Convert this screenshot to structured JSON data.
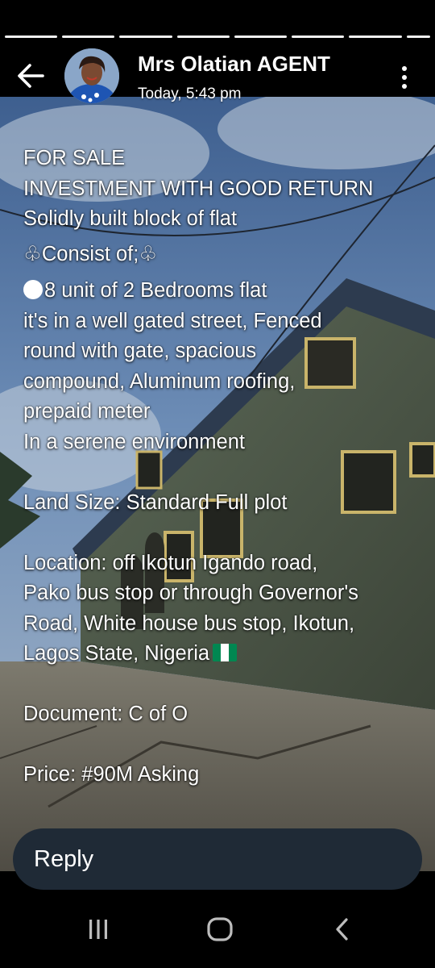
{
  "status": {
    "segments_total": 8,
    "segments_viewed": 8
  },
  "header": {
    "author_name": "Mrs Olatian AGENT",
    "timestamp": "Today, 5:43 pm",
    "back_icon": "arrow-left-icon",
    "menu_icon": "more-vertical-icon"
  },
  "post": {
    "lines": [
      "FOR SALE",
      "INVESTMENT WITH GOOD RETURN",
      "Solidly built block of flat",
      "Consist of;",
      "8 unit of 2 Bedrooms flat",
      "it's in a well gated street, Fenced",
      "round with gate, spacious",
      "compound, Aluminum roofing,",
      "prepaid meter",
      "In a serene environment",
      "Land Size: Standard Full plot",
      "Location: off Ikotun Igando road,",
      "Pako bus stop or through Governor's",
      "Road, White house bus stop, Ikotun,",
      "Lagos State, Nigeria",
      "Document: C of O",
      "Price: #90M Asking"
    ],
    "club_glyph": "♧"
  },
  "reply": {
    "label": "Reply"
  },
  "nav": {
    "recents_icon": "recents-icon",
    "home_icon": "home-icon",
    "back_icon": "nav-back-icon"
  },
  "colors": {
    "reply_bar": "#1f2a36",
    "flag_green": "#008751",
    "text": "#ffffff"
  }
}
